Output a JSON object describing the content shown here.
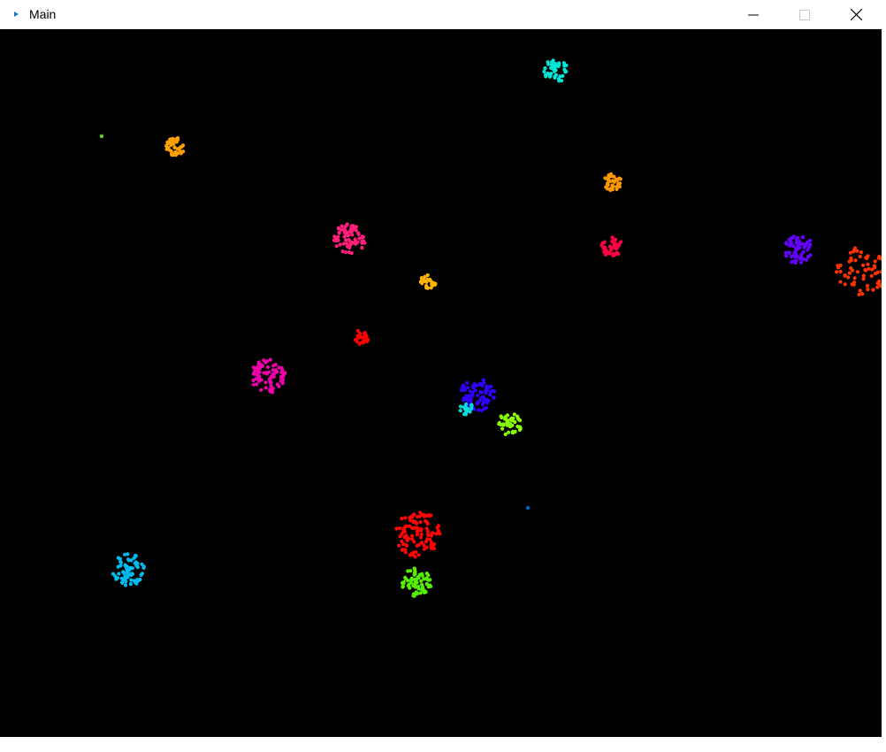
{
  "window": {
    "title": "Main"
  },
  "titlebar_buttons": {
    "minimize": "minimize-icon",
    "maximize": "maximize-icon",
    "close": "close-icon"
  },
  "canvas": {
    "background": "#000000"
  },
  "particle_clusters": [
    {
      "color": "#00e5d5"
    },
    {
      "color": "#ffa200"
    },
    {
      "color": "#66cc22"
    },
    {
      "color": "#ff9900"
    },
    {
      "color": "#ff1f7a"
    },
    {
      "color": "#ff0044"
    },
    {
      "color": "#6600ff"
    },
    {
      "color": "#ff3300"
    },
    {
      "color": "#ffb300"
    },
    {
      "color": "#ff0000"
    },
    {
      "color": "#ee00aa"
    },
    {
      "color": "#3300ff"
    },
    {
      "color": "#00dddd"
    },
    {
      "color": "#88ff00"
    },
    {
      "color": "#0066cc"
    },
    {
      "color": "#ff0505"
    },
    {
      "color": "#00bbee"
    },
    {
      "color": "#55ee00"
    }
  ]
}
